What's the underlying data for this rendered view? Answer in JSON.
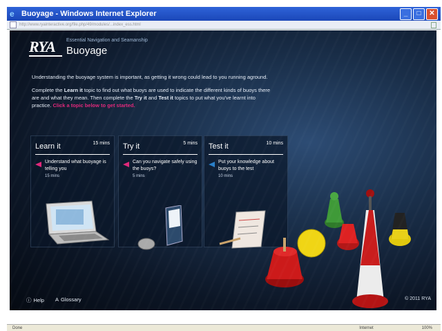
{
  "window": {
    "title": "Buoyage - Windows Internet Explorer",
    "address": "http://www.ryainteractive.org/file.php/49/modules/...index_ess.html",
    "address_domain": "ryainteractive.org"
  },
  "app": {
    "logo": "RYA",
    "subtitle": "Essential Navigation and Seamanship",
    "title": "Buoyage",
    "intro_1": "Understanding the buoyage system is important, as getting it wrong could lead to you running aground.",
    "intro_2a": "Complete the ",
    "intro_2_learn": "Learn it",
    "intro_2b": " topic to find out what buoys are used to indicate the different kinds of buoys there are and what they mean. Then complete the ",
    "intro_2_try": "Try it",
    "intro_2c": " and ",
    "intro_2_test": "Test it",
    "intro_2d": " topics to put what you've learnt into practice. ",
    "intro_cta": "Click a topic below to get started."
  },
  "cards": [
    {
      "title": "Learn it",
      "mins": "15 mins",
      "desc": "Understand what buoyage is telling you",
      "time": "15 mins",
      "arrow_color": "#e0287a"
    },
    {
      "title": "Try it",
      "mins": "5 mins",
      "desc": "Can you navigate safely using the buoys?",
      "time": "5 mins",
      "arrow_color": "#e0287a"
    },
    {
      "title": "Test it",
      "mins": "10 mins",
      "desc": "Put your knowledge about buoys to the test",
      "time": "10 mins",
      "arrow_color": "#2a7fc8"
    }
  ],
  "footer": {
    "help": "Help",
    "glossary": "Glossary",
    "copyright": "© 2011 RYA"
  },
  "statusbar": {
    "left": "Done",
    "zone": "Internet",
    "zoom": "100%"
  },
  "colors": {
    "accent_pink": "#e0287a",
    "accent_blue": "#2a7fc8",
    "titlebar_blue": "#1b47b8"
  }
}
